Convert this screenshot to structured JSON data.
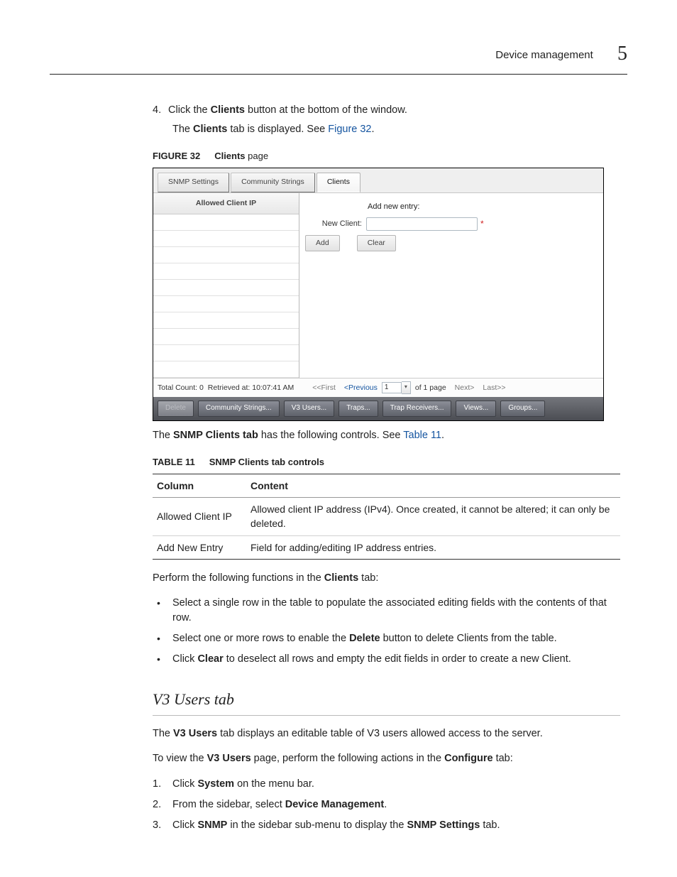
{
  "header": {
    "section": "Device management",
    "chapter_number": "5"
  },
  "step4": {
    "number": "4.",
    "line_prefix": "Click the ",
    "line_bold": "Clients",
    "line_suffix": " button at the bottom of the window.",
    "body_prefix": "The ",
    "body_bold": "Clients",
    "body_mid": " tab is displayed. See ",
    "body_link": "Figure 32",
    "body_dot": "."
  },
  "figure_caption": {
    "label": "FIGURE 32",
    "bold": "Clients",
    "rest": " page"
  },
  "figure": {
    "tabs": {
      "snmp": "SNMP Settings",
      "community": "Community Strings",
      "clients": "Clients"
    },
    "left_header": "Allowed Client IP",
    "right": {
      "add_new_entry": "Add new entry:",
      "new_client_label": "New Client:",
      "add_btn": "Add",
      "clear_btn": "Clear"
    },
    "status": {
      "total_count": "Total Count: 0",
      "retrieved": "Retrieved at: 10:07:41 AM",
      "first": "<<First",
      "prev": "<Previous",
      "page_value": "1",
      "of": "of 1 page",
      "next": "Next>",
      "last": "Last>>"
    },
    "footer": [
      "Delete",
      "Community Strings...",
      "V3 Users...",
      "Traps...",
      "Trap Receivers...",
      "Views...",
      "Groups..."
    ]
  },
  "para_after_figure": {
    "pre": "The ",
    "bold": "SNMP Clients tab",
    "mid": " has the following controls. See ",
    "link": "Table 11",
    "dot": "."
  },
  "table_caption": {
    "label": "TABLE 11",
    "text": "SNMP Clients tab controls"
  },
  "table": {
    "head": [
      "Column",
      "Content"
    ],
    "rows": [
      [
        "Allowed Client IP",
        "Allowed client IP address (IPv4). Once created, it cannot be altered; it can only be deleted."
      ],
      [
        "Add New Entry",
        "Field for adding/editing IP address entries."
      ]
    ]
  },
  "perform": {
    "pre": "Perform the following functions in the ",
    "bold": "Clients",
    "post": " tab:"
  },
  "bullets": [
    {
      "text": "Select a single row in the table to populate the associated editing fields with the contents of that row."
    },
    {
      "pre": "Select one or more rows to enable the ",
      "bold": "Delete",
      "post": " button to delete Clients from the table."
    },
    {
      "pre": "Click ",
      "bold": "Clear",
      "post": " to deselect all rows and empty the edit fields in order to create a new Client."
    }
  ],
  "h3": "V3 Users tab",
  "v3_intro": {
    "pre": "The ",
    "bold": "V3 Users",
    "post": " tab displays an editable table of V3 users allowed access to the server."
  },
  "v3_to_view": {
    "pre": "To view the ",
    "bold1": "V3 Users",
    "mid": " page, perform the following actions in the ",
    "bold2": "Configure",
    "post": " tab:"
  },
  "v3_steps": [
    {
      "n": "1.",
      "pre": "Click ",
      "bold": "System",
      "post": " on the menu bar."
    },
    {
      "n": "2.",
      "pre": "From the sidebar, select ",
      "bold": "Device Management",
      "post": "."
    },
    {
      "n": "3.",
      "pre": "Click ",
      "bold1": "SNMP",
      "mid": " in the sidebar sub-menu to display the ",
      "bold2": "SNMP Settings",
      "post": " tab."
    }
  ]
}
